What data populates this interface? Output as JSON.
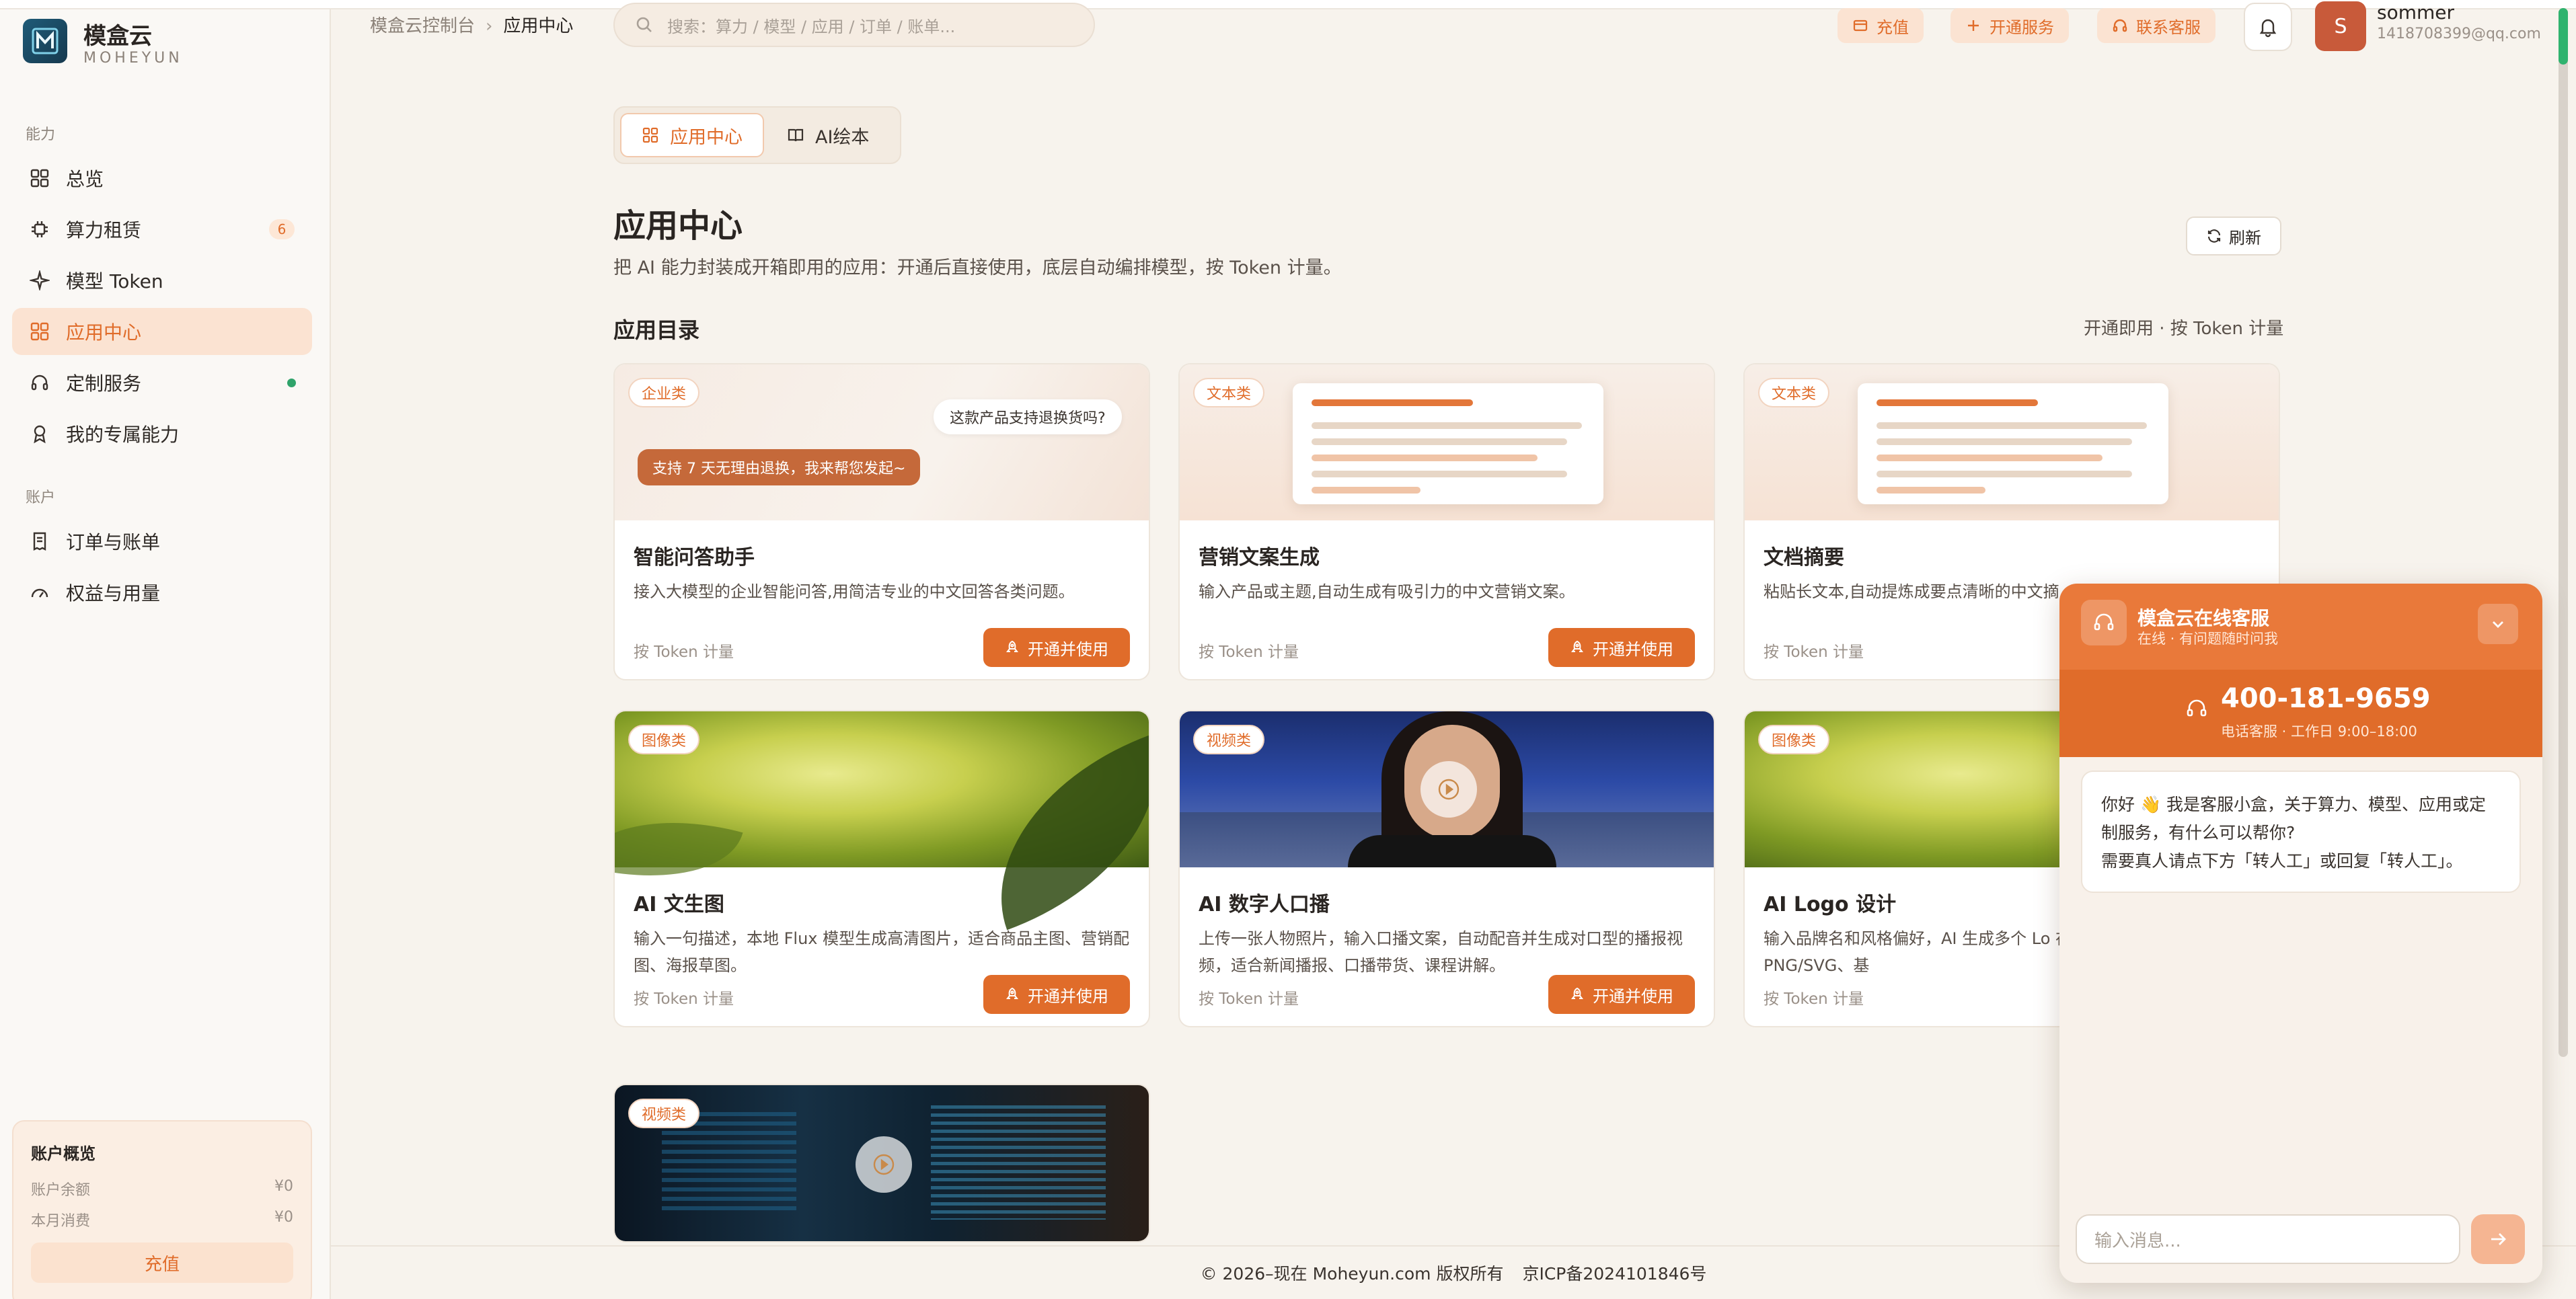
{
  "brand": {
    "name_cn": "模盒云",
    "name_en": "MOHEYUN"
  },
  "sidebar": {
    "section_ability": "能力",
    "section_account": "账户",
    "items": [
      {
        "label": "总览",
        "icon": "grid-icon"
      },
      {
        "label": "算力租赁",
        "icon": "chip-icon",
        "badge": "6"
      },
      {
        "label": "模型 Token",
        "icon": "sparkle-icon"
      },
      {
        "label": "应用中心",
        "icon": "apps-icon",
        "active": true
      },
      {
        "label": "定制服务",
        "icon": "headset-icon",
        "status_color": "#2fa36a"
      },
      {
        "label": "我的专属能力",
        "icon": "award-icon"
      },
      {
        "label": "订单与账单",
        "icon": "receipt-icon"
      },
      {
        "label": "权益与用量",
        "icon": "gauge-icon"
      }
    ],
    "account_card": {
      "title": "账户概览",
      "balance_label": "账户余额",
      "balance_value": "¥0",
      "month_label": "本月消费",
      "month_value": "¥0",
      "recharge": "充值"
    }
  },
  "header": {
    "breadcrumb_root": "模盒云控制台",
    "breadcrumb_current": "应用中心",
    "search_placeholder": "搜索：算力 / 模型 / 应用 / 订单 / 账单...",
    "btn_recharge": "充值",
    "btn_open_service": "开通服务",
    "btn_contact": "联系客服",
    "user_initial": "S",
    "user_name": "sommer",
    "user_email": "1418708399@qq.com"
  },
  "tabs": [
    {
      "label": "应用中心"
    },
    {
      "label": "AI绘本"
    }
  ],
  "page": {
    "title": "应用中心",
    "subtitle": "把 AI 能力封装成开箱即用的应用：开通后直接使用，底层自动编排模型，按 Token 计量。",
    "refresh": "刷新",
    "section_title": "应用目录",
    "section_hint": "开通即用 · 按 Token 计量"
  },
  "cards": [
    {
      "tag": "企业类",
      "title": "智能问答助手",
      "desc": "接入大模型的企业智能问答,用简洁专业的中文回答各类问题。",
      "meter": "按 Token 计量",
      "action": "开通并使用",
      "bubble_q": "这款产品支持退换货吗?",
      "bubble_a": "支持 7 天无理由退换，我来帮您发起~"
    },
    {
      "tag": "文本类",
      "title": "营销文案生成",
      "desc": "输入产品或主题,自动生成有吸引力的中文营销文案。",
      "meter": "按 Token 计量",
      "action": "开通并使用"
    },
    {
      "tag": "文本类",
      "title": "文档摘要",
      "desc": "粘贴长文本,自动提炼成要点清晰的中文摘",
      "meter": "按 Token 计量"
    },
    {
      "tag": "图像类",
      "title": "AI 文生图",
      "desc": "输入一句描述，本地 Flux 模型生成高清图片，适合商品主图、营销配图、海报草图。",
      "meter": "按 Token 计量",
      "action": "开通并使用"
    },
    {
      "tag": "视频类",
      "title": "AI 数字人口播",
      "desc": "上传一张人物照片，输入口播文案，自动配音并生成对口型的播报视频，适合新闻播报、口播带货、课程讲解。",
      "meter": "按 Token 计量",
      "action": "开通并使用"
    },
    {
      "tag": "图像类",
      "title": "AI Logo 设计",
      "desc": "输入品牌名和风格偏好，AI 生成多个 Lo 在线编辑文字排版、下载 PNG/SVG、基",
      "meter": "按 Token 计量"
    },
    {
      "tag": "视频类"
    }
  ],
  "footer": {
    "copyright": "© 2026–现在 Moheyun.com 版权所有",
    "icp": "京ICP备2024101846号"
  },
  "chat": {
    "title": "模盒云在线客服",
    "status": "在线 · 有问题随时问我",
    "phone": "400-181-9659",
    "phone_hint": "电话客服 · 工作日 9:00–18:00",
    "greeting": "你好 👋 我是客服小盒，关于算力、模型、应用或定制服务，有什么可以帮你?",
    "greeting_2": "需要真人请点下方「转人工」或回复「转人工」。",
    "input_placeholder": "输入消息..."
  },
  "colors": {
    "accent": "#e06c2a",
    "accent_soft": "#fbe3d2",
    "online": "#2fa36a",
    "bg": "#f7f3ed"
  }
}
